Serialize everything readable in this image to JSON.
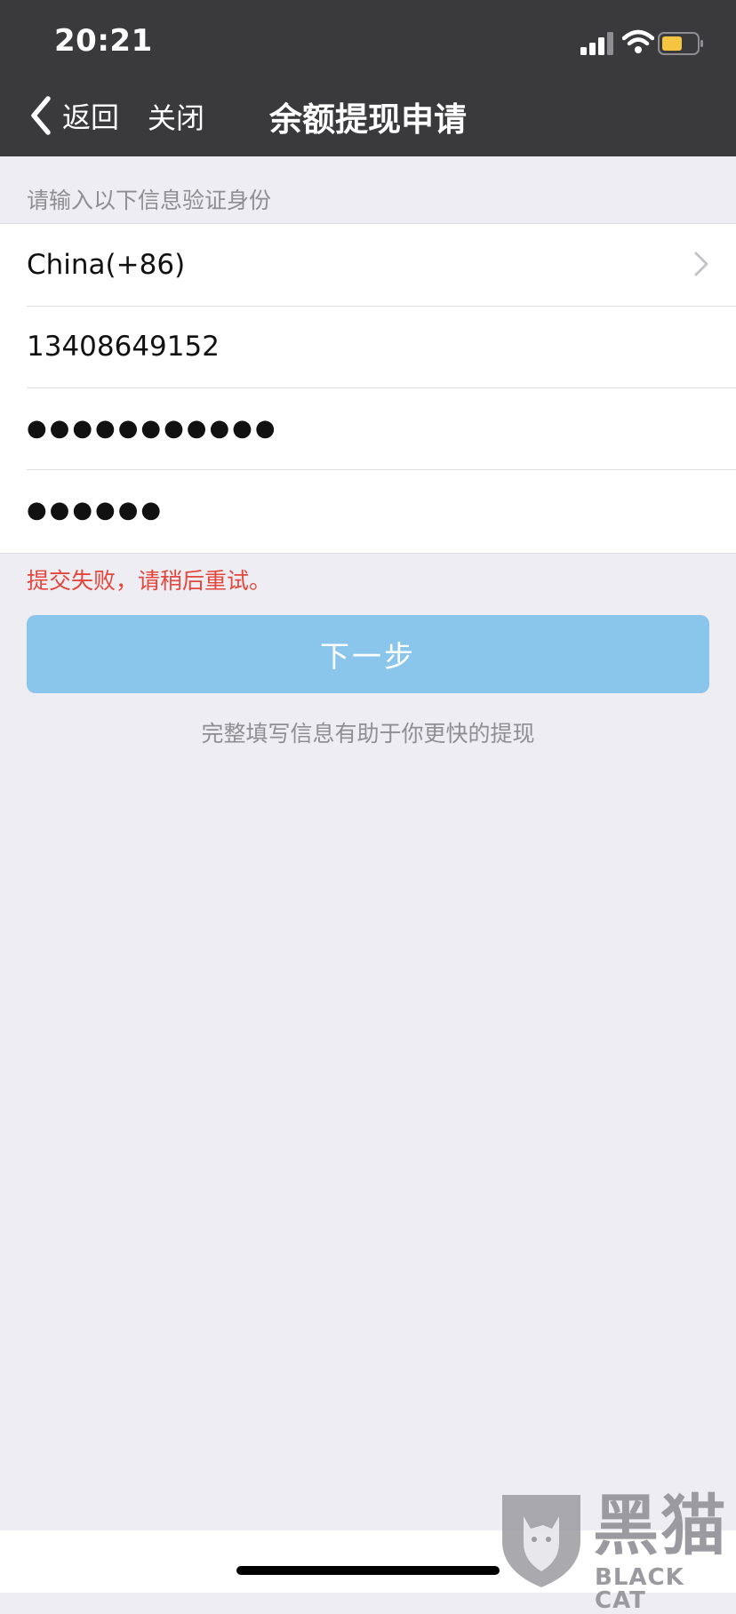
{
  "status_bar": {
    "time": "20:21"
  },
  "nav": {
    "back_label": "返回",
    "close_label": "关闭",
    "title": "余额提现申请"
  },
  "form": {
    "section_label": "请输入以下信息验证身份",
    "country_value": "China(+86)",
    "phone_value": "13408649152",
    "masked_field_1": "●●●●●●●●●●●",
    "masked_field_2": "●●●●●●"
  },
  "error_message": "提交失败，请稍后重试。",
  "next_button_label": "下一步",
  "helper_text": "完整填写信息有助于你更快的提现",
  "watermark": {
    "cn": "黑猫",
    "en": "BLACK CAT"
  },
  "colors": {
    "header_bg": "#3a3a3c",
    "page_bg": "#ededf3",
    "button_bg": "#8ac5ec",
    "error": "#e5463c",
    "battery": "#f5c542"
  }
}
